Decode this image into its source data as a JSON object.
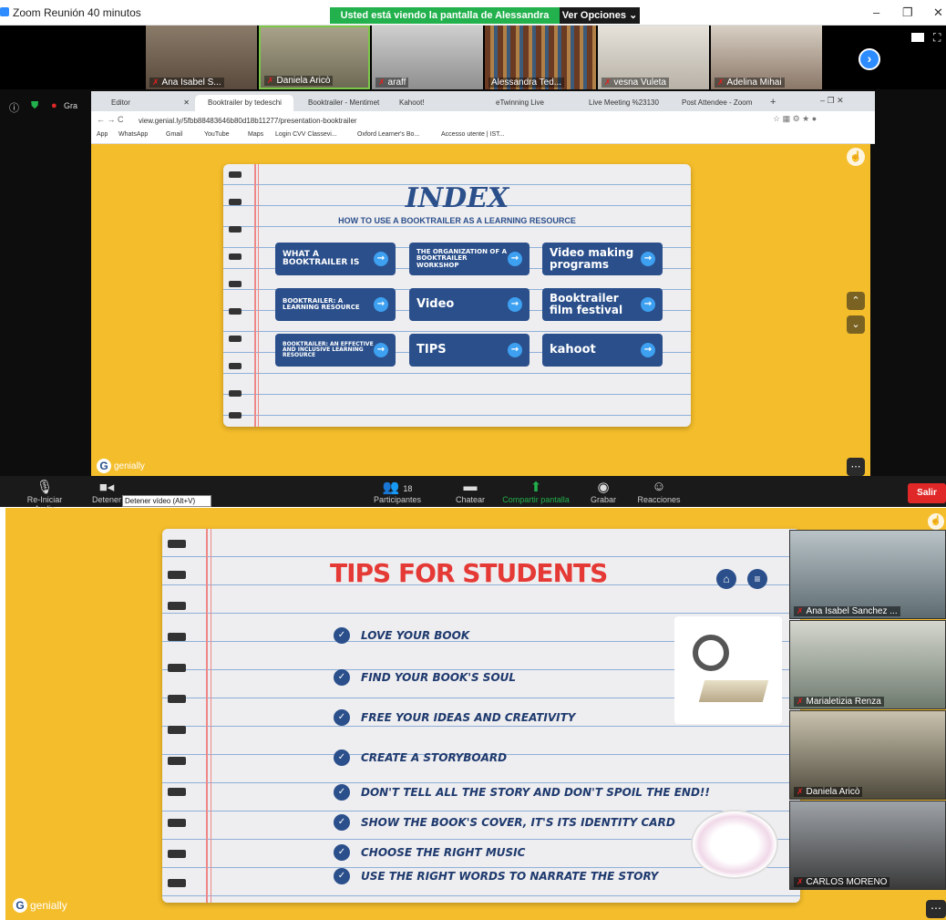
{
  "zoom": {
    "window_title": "Zoom Reunión 40 minutos",
    "share_banner": "Usted está viendo la pantalla de Alessandra Tedeschi",
    "view_options": "Ver Opciones",
    "participants_top": [
      {
        "name": "Ana Isabel S..."
      },
      {
        "name": "Daniela Aricò"
      },
      {
        "name": "araff"
      },
      {
        "name": "Alessandra Ted..."
      },
      {
        "name": "vesna Vuleta"
      },
      {
        "name": "Adelina Mihai"
      }
    ],
    "toolbar": {
      "audio": "Re-Iniciar Audio",
      "video": "Detener",
      "video_tooltip": "Detener vídeo (Alt+V)",
      "participants_label": "Participantes",
      "participants_count": "18",
      "chat": "Chatear",
      "share": "Compartir pantalla",
      "record": "Grabar",
      "reactions": "Reacciones",
      "leave": "Salir"
    },
    "side_videos": [
      {
        "name": "Ana Isabel Sanchez ..."
      },
      {
        "name": "Marialetizia Renza"
      },
      {
        "name": "Daniela Aricò"
      },
      {
        "name": "CARLOS MORENO"
      }
    ]
  },
  "browser": {
    "tabs": [
      "Editor",
      "Booktrailer by tedeschi",
      "Booktrailer - Mentimet",
      "Kahoot!",
      "eTwinning Live",
      "Live Meeting %23130",
      "Post Attendee - Zoom"
    ],
    "url": "view.genial.ly/5fbb88483646b80d18b11277/presentation-booktrailer",
    "bookmarks": [
      "App",
      "WhatsApp",
      "Gmail",
      "YouTube",
      "Maps",
      "Login CVV Classevi...",
      "Oxford Learner's Bo...",
      "Accesso utente | IST..."
    ],
    "left_truncated": "Gra"
  },
  "slide_index": {
    "title": "INDEX",
    "subtitle": "HOW TO USE A BOOKTRAILER AS A LEARNING RESOURCE",
    "buttons": [
      {
        "label": "WHAT A BOOKTRAILER IS"
      },
      {
        "label": "THE ORGANIZATION OF A BOOKTRAILER WORKSHOP"
      },
      {
        "label": "Video making programs"
      },
      {
        "label": "BOOKTRAILER: A LEARNING RESOURCE"
      },
      {
        "label": "Video"
      },
      {
        "label": "Booktrailer film festival"
      },
      {
        "label": "BOOKTRAILER: AN EFFECTIVE AND INCLUSIVE LEARNING RESOURCE"
      },
      {
        "label": "TIPS"
      },
      {
        "label": "kahoot"
      }
    ],
    "brand": "genially"
  },
  "slide_tips": {
    "title": "TIPS FOR STUDENTS",
    "tips": [
      "LOVE YOUR BOOK",
      "FIND YOUR BOOK'S SOUL",
      "FREE YOUR IDEAS AND CREATIVITY",
      "CREATE A STORYBOARD",
      "DON'T TELL ALL THE STORY AND DON'T SPOIL THE END!!",
      "SHOW THE BOOK'S COVER, IT'S ITS IDENTITY CARD",
      "CHOOSE THE RIGHT MUSIC",
      "USE THE RIGHT WORDS TO NARRATE THE STORY"
    ],
    "brand": "genially"
  },
  "colors": {
    "accent_yellow": "#f4bd2b",
    "navy": "#2a4f8b",
    "title_red": "#e53935"
  }
}
